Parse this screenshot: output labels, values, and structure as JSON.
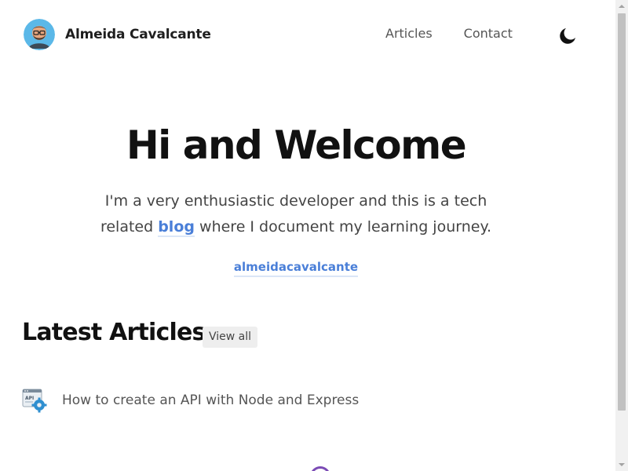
{
  "header": {
    "brand_name": "Almeida Cavalcante",
    "nav": [
      {
        "label": "Articles"
      },
      {
        "label": "Contact"
      }
    ],
    "theme_toggle_icon": "moon-icon"
  },
  "hero": {
    "title": "Hi and Welcome",
    "text_line1": "I'm a very enthusiastic developer and this is a tech",
    "text_prefix": "related ",
    "blog_link": "blog",
    "text_suffix": " where I document my learning journey.",
    "handle": "almeidacavalcante"
  },
  "latest": {
    "title": "Latest Articles",
    "view_all": "View all",
    "articles": [
      {
        "title": "How to create an API with Node and Express",
        "icon": "api-gear-icon"
      }
    ]
  },
  "colors": {
    "link": "#4a7fd8",
    "text": "#111111",
    "muted": "#555555"
  }
}
